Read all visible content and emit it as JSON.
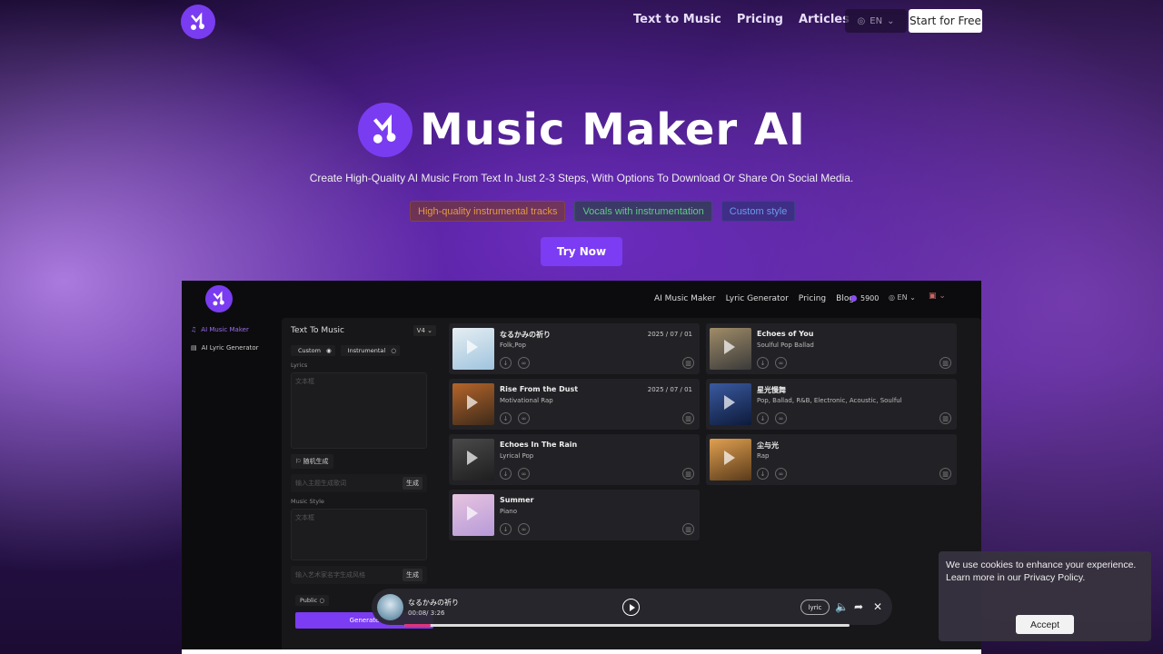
{
  "nav": {
    "links": [
      "Text to Music",
      "Pricing",
      "Articles"
    ],
    "language": "EN",
    "start_label": "Start for Free"
  },
  "hero": {
    "title": "Music Maker AI",
    "subtitle": "Create High-Quality AI Music From Text In Just 2-3 Steps, With Options To Download Or Share On Social Media.",
    "tags": [
      "High-quality instrumental tracks",
      "Vocals with instrumentation",
      "Custom style"
    ],
    "cta": "Try Now"
  },
  "app": {
    "nav": [
      "AI Music Maker",
      "Lyric Generator",
      "Pricing",
      "Blog"
    ],
    "credits": "5900",
    "language": "EN",
    "sidebar": [
      "AI Music Maker",
      "AI Lyric Generator"
    ],
    "form": {
      "title": "Text To Music",
      "version": "V4",
      "custom_label": "Custom",
      "instrumental_label": "Instrumental",
      "lyrics_label": "Lyrics",
      "lyrics_placeholder": "文本框",
      "random_label": "随机生成",
      "theme_placeholder": "输入主题生成歌词",
      "generate_small": "生成",
      "style_label": "Music Style",
      "style_placeholder": "文本框",
      "style_input_placeholder": "输入艺术家名字生成风格",
      "public_label": "Public",
      "generate_label": "Generate"
    },
    "songs": [
      {
        "title": "なるかみの祈り",
        "genre": "Folk,Pop",
        "date": "2025 / 07 / 01",
        "color_a": "#9fc4de",
        "color_b": "#e6eef2"
      },
      {
        "title": "Echoes of You",
        "genre": "Soulful Pop Ballad",
        "date": "",
        "color_a": "#3a3a3a",
        "color_b": "#a08c68"
      },
      {
        "title": "Rise From the Dust",
        "genre": "Motivational Rap",
        "date": "2025 / 07 / 01",
        "color_a": "#3d2a1a",
        "color_b": "#b5652a"
      },
      {
        "title": "星光慢舞",
        "genre": "Pop, Ballad, R&B, Electronic, Acoustic, Soulful",
        "date": "",
        "color_a": "#0d1a3a",
        "color_b": "#3a5aa0"
      },
      {
        "title": "Echoes In The Rain",
        "genre": "Lyrical Pop",
        "date": "",
        "color_a": "#1e1e1e",
        "color_b": "#4a4a4a"
      },
      {
        "title": "尘与光",
        "genre": "Rap",
        "date": "",
        "color_a": "#5a3a1a",
        "color_b": "#e0a050"
      },
      {
        "title": "Summer",
        "genre": "Piano",
        "date": "",
        "color_a": "#b69ad8",
        "color_b": "#e8c4e0"
      }
    ]
  },
  "player": {
    "title": "なるかみの祈り",
    "time": "00:08/ 3:26",
    "progress": 0.06,
    "lyric_label": "lyric"
  },
  "cookie": {
    "text": "We use cookies to enhance your experience. Learn more in our Privacy Policy.",
    "accept_label": "Accept"
  }
}
